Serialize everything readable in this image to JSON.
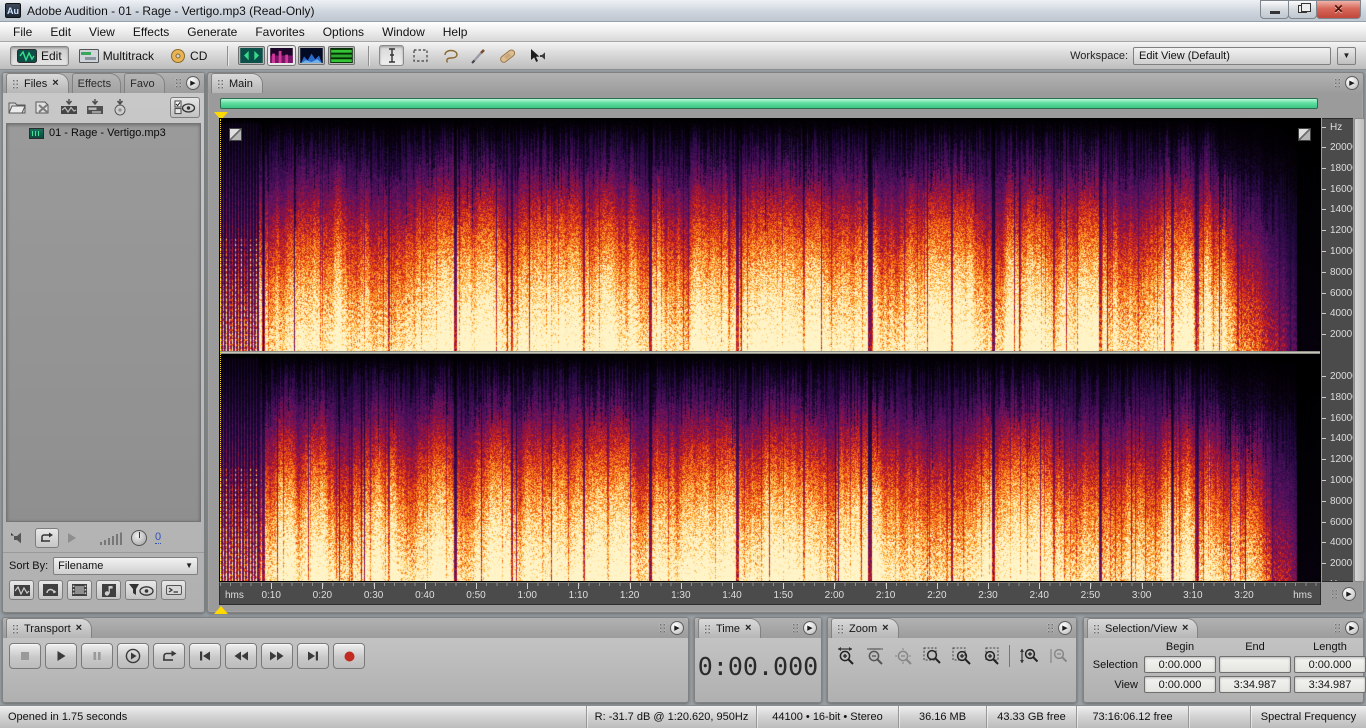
{
  "ui": {
    "close_glyph": "×",
    "close_x": "✕",
    "dropdown_arrow": "▼",
    "panel_menu_arrow": "▶"
  },
  "window": {
    "title": "Adobe Audition - 01 - Rage - Vertigo.mp3 (Read-Only)",
    "app_icon_label": "Au"
  },
  "menu": {
    "items": [
      "File",
      "Edit",
      "View",
      "Effects",
      "Generate",
      "Favorites",
      "Options",
      "Window",
      "Help"
    ]
  },
  "toolbar": {
    "edit_label": "Edit",
    "multitrack_label": "Multitrack",
    "cd_label": "CD",
    "workspace_label": "Workspace:",
    "workspace_value": "Edit View (Default)"
  },
  "files_panel": {
    "tab_files": "Files",
    "tab_effects": "Effects",
    "tab_favorites": "Favo",
    "file_name": "01 - Rage - Vertigo.mp3",
    "sort_by_label": "Sort By:",
    "sort_by_value": "Filename",
    "autoplay_volume": "0"
  },
  "main_panel": {
    "tab_label": "Main",
    "freq_unit": "Hz",
    "freq_ticks": [
      "20000",
      "18000",
      "16000",
      "14000",
      "12000",
      "10000",
      "8000",
      "6000",
      "4000",
      "2000"
    ],
    "time_unit_left": "hms",
    "time_unit_right": "hms",
    "time_ticks": [
      "0:10",
      "0:20",
      "0:30",
      "0:40",
      "0:50",
      "1:00",
      "1:10",
      "1:20",
      "1:30",
      "1:40",
      "1:50",
      "2:00",
      "2:10",
      "2:20",
      "2:30",
      "2:40",
      "2:50",
      "3:00",
      "3:10",
      "3:20"
    ]
  },
  "transport_panel": {
    "title": "Transport"
  },
  "time_panel": {
    "title": "Time",
    "value": "0:00.000"
  },
  "zoom_panel": {
    "title": "Zoom"
  },
  "selection_panel": {
    "title": "Selection/View",
    "col_headers": [
      "Begin",
      "End",
      "Length"
    ],
    "row_labels": [
      "Selection",
      "View"
    ],
    "selection": {
      "begin": "0:00.000",
      "end": "",
      "length": "0:00.000"
    },
    "view": {
      "begin": "0:00.000",
      "end": "3:34.987",
      "length": "3:34.987"
    }
  },
  "status_bar": {
    "left_text": "Opened in 1.75 seconds",
    "cells": [
      "R: -31.7 dB @  1:20.620, 950Hz",
      "44100 • 16-bit • Stereo",
      "36.16 MB",
      "43.33 GB free",
      "73:16:06.12 free",
      "",
      "Spectral Frequency"
    ]
  },
  "spectrogram": {
    "channels": 2,
    "duration_s": 215,
    "intro_end_s": 7.5,
    "fade_start_s": 195,
    "black_start_s": 210.5,
    "bright_band_s": [
      192.3,
      193.6
    ],
    "gaps": [
      [
        8.4,
        0.3,
        0.45
      ],
      [
        33,
        0.2,
        0.6
      ],
      [
        46,
        0.3,
        0.35
      ],
      [
        57,
        0.25,
        0.5
      ],
      [
        71,
        0.2,
        0.6
      ],
      [
        84,
        0.3,
        0.4
      ],
      [
        101,
        0.3,
        0.45
      ],
      [
        114,
        0.2,
        0.6
      ],
      [
        127,
        0.35,
        0.3
      ],
      [
        143,
        0.25,
        0.5
      ],
      [
        151,
        0.3,
        0.4
      ],
      [
        163,
        0.2,
        0.6
      ],
      [
        172,
        0.3,
        0.45
      ],
      [
        186,
        0.3,
        0.5
      ],
      [
        190.8,
        0.4,
        0.5
      ]
    ],
    "colormap": [
      [
        0,
        "#000000"
      ],
      [
        0.13,
        "#20093d"
      ],
      [
        0.29,
        "#5c1264"
      ],
      [
        0.44,
        "#a31335"
      ],
      [
        0.57,
        "#e03414"
      ],
      [
        0.7,
        "#f97a16"
      ],
      [
        0.82,
        "#ffb340"
      ],
      [
        0.92,
        "#ffdb7d"
      ],
      [
        1,
        "#fff3c8"
      ]
    ]
  }
}
